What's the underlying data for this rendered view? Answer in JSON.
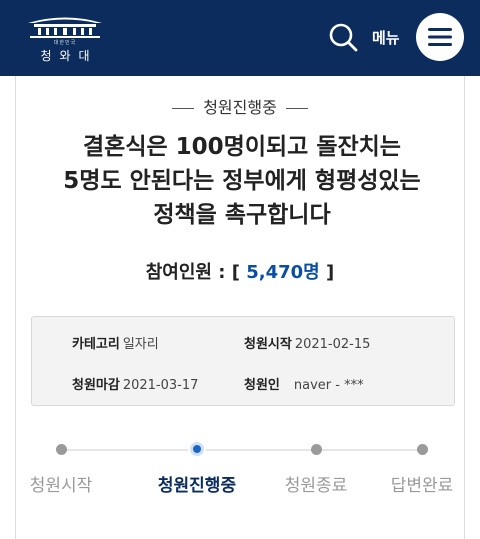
{
  "header": {
    "logo_sub": "대한민국",
    "logo_name": "청와대",
    "menu_label": "메뉴"
  },
  "petition": {
    "status": "청원진행중",
    "title": "결혼식은 100명이되고 돌잔치는 5명도 안된다는 정부에게 형평성있는 정책을 촉구합니다",
    "count_label": "참여인원 : [",
    "count_value": "5,470명",
    "count_suffix": "]",
    "info": {
      "category_label": "카테고리",
      "category_value": "일자리",
      "start_label": "청원시작",
      "start_value": "2021-02-15",
      "end_label": "청원마감",
      "end_value": "2021-03-17",
      "author_label": "청원인",
      "author_value": "naver - ***"
    }
  },
  "progress": {
    "steps": [
      {
        "label": "청원시작"
      },
      {
        "label": "청원진행중"
      },
      {
        "label": "청원종료"
      },
      {
        "label": "답변완료"
      }
    ],
    "active_index": 1
  },
  "colors": {
    "header_bg": "#0b2c5c",
    "accent": "#1e63c6",
    "count_text": "#0b4ea2"
  }
}
